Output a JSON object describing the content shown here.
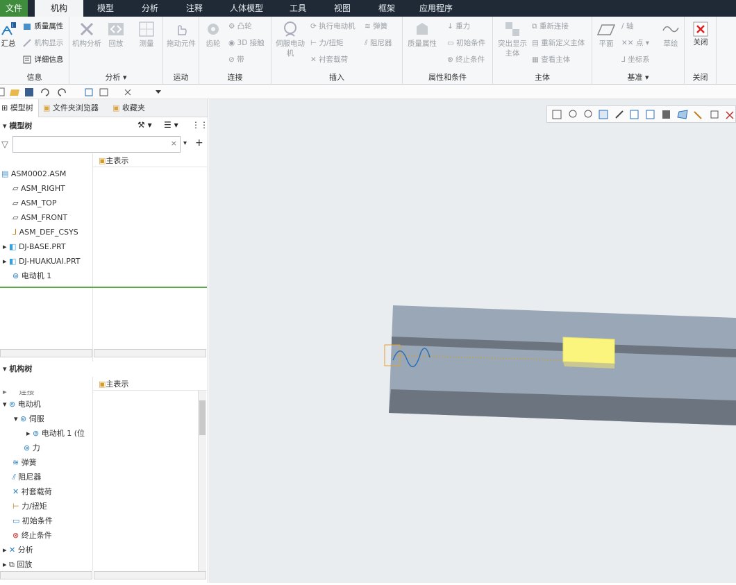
{
  "menu": {
    "tabs": [
      "文件",
      "机构",
      "模型",
      "分析",
      "注释",
      "人体模型",
      "工具",
      "视图",
      "框架",
      "应用程序"
    ],
    "active": "机构"
  },
  "ribbon": {
    "info": {
      "label": "信息",
      "summary": "汇总",
      "mass_props": "质量属性",
      "mech_display": "机构显示",
      "details": "详细信息"
    },
    "analysis": {
      "label": "分析",
      "mech_analysis": "机构分析",
      "playback": "回放",
      "measure": "测量"
    },
    "motion": {
      "label": "运动",
      "drag": "拖动元件"
    },
    "connect": {
      "label": "连接",
      "gear": "齿轮",
      "cam": "凸轮",
      "contact3d": "3D 接触",
      "belt": "带"
    },
    "insert": {
      "label": "插入",
      "servo": "伺服电动机",
      "run_motor": "执行电动机",
      "force": "力/扭矩",
      "bushing": "衬套载荷",
      "spring": "弹簧",
      "damper": "阻尼器"
    },
    "props": {
      "label": "属性和条件",
      "mass": "质量属性",
      "gravity": "重力",
      "init_cond": "初始条件",
      "term_cond": "终止条件"
    },
    "body": {
      "label": "主体",
      "highlight": "突出显示主体",
      "reconnect": "重新连接",
      "redefine": "重新定义主体",
      "view": "查看主体"
    },
    "datum": {
      "label": "基准",
      "plane": "平面",
      "axis": "轴",
      "point": "点",
      "csys": "坐标系",
      "sketch": "草绘"
    },
    "close": {
      "label": "关闭",
      "close": "关闭"
    }
  },
  "panel": {
    "tabs": [
      "模型树",
      "文件夹浏览器",
      "收藏夹"
    ],
    "model_tree_title": "模型树",
    "col_header": "主表示",
    "model_items": [
      "ASM0002.ASM",
      "ASM_RIGHT",
      "ASM_TOP",
      "ASM_FRONT",
      "ASM_DEF_CSYS",
      "DJ-BASE.PRT",
      "DJ-HUAKUAI.PRT",
      "电动机 1"
    ],
    "mech_tree_title": "机构树",
    "mech_col_header": "主表示",
    "mech_items": [
      "连接",
      "电动机",
      "伺服",
      "电动机 1 (位",
      "力",
      "弹簧",
      "阻尼器",
      "衬套载荷",
      "力/扭矩",
      "初始条件",
      "终止条件",
      "分析",
      "回放"
    ]
  },
  "colors": {
    "menubar": "#1f2a36",
    "file_tab": "#3f8c3c",
    "viewport": "#eaedf0",
    "part_top": "#9aa7b7",
    "part_dark": "#6c7480",
    "block": "#fbf57d"
  }
}
